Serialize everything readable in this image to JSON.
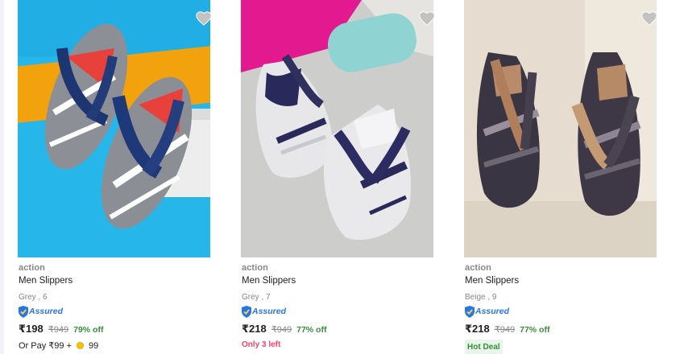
{
  "products": [
    {
      "brand": "action",
      "title": "Men Slippers",
      "variant": "Grey , 6",
      "assured": "Assured",
      "price": "₹198",
      "mrp": "₹949",
      "discount": "79% off",
      "or_pay": "Or Pay ₹99 +",
      "coins": "99",
      "image_icon": "slipper-photo-blue",
      "wishlist_icon": "heart-icon"
    },
    {
      "brand": "action",
      "title": "Men Slippers",
      "variant": "Grey , 7",
      "assured": "Assured",
      "price": "₹218",
      "mrp": "₹949",
      "discount": "77% off",
      "stock_note": "Only 3 left",
      "image_icon": "slipper-photo-grey",
      "wishlist_icon": "heart-icon"
    },
    {
      "brand": "action",
      "title": "Men Slippers",
      "variant": "Beige , 9",
      "assured": "Assured",
      "price": "₹218",
      "mrp": "₹949",
      "discount": "77% off",
      "deal_badge": "Hot Deal",
      "image_icon": "slipper-photo-beige",
      "wishlist_icon": "heart-icon"
    }
  ],
  "colors": {
    "accent": "#2874f0",
    "discount": "#388e3c",
    "stock": "#ff3e6c",
    "muted": "#878787"
  }
}
